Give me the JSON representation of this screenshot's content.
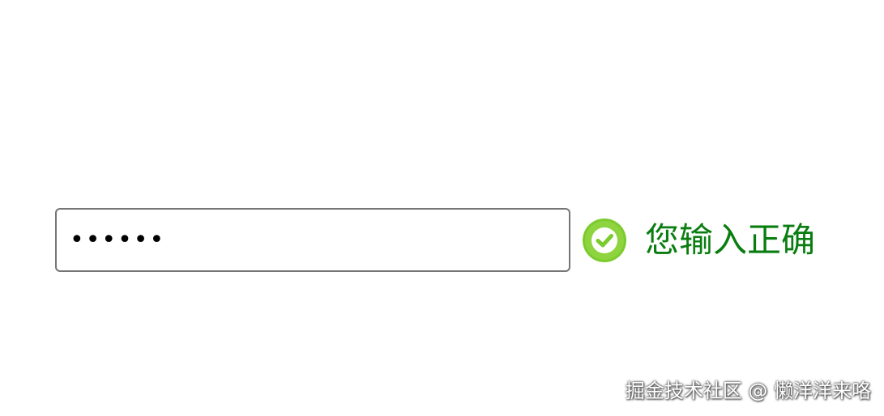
{
  "password_field": {
    "masked_value": "••••••"
  },
  "validation": {
    "icon": "check-circle-icon",
    "message": "您输入正确",
    "message_color": "#0a7d10",
    "icon_color": "#7ccb2e"
  },
  "watermark": {
    "text": "掘金技术社区 @ 懒洋洋来咯"
  }
}
